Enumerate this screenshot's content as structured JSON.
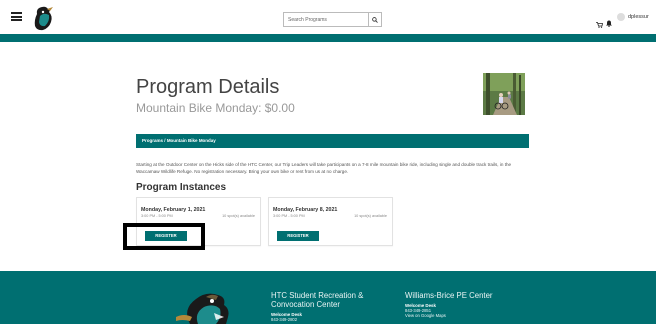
{
  "header": {
    "search_placeholder": "Search Programs",
    "username": "dplessur"
  },
  "program": {
    "title": "Program Details",
    "subtitle": "Mountain Bike Monday: $0.00",
    "breadcrumb": [
      "Programs",
      "Mountain Bike Monday"
    ],
    "breadcrumb_sep": "/",
    "description": "Starting at the Outdoor Center on the Hicks side of the HTC Center, our Trip Leaders will take participants on a 7-8 mile mountain bike ride, including single and double track trails, in the Waccamaw Wildlife Refuge. No registration necessary. Bring your own bike or rent from us at no charge."
  },
  "instances": {
    "heading": "Program Instances",
    "items": [
      {
        "date": "Monday, February 1, 2021",
        "time": "3:00 PM - 5:00 PM",
        "spots": "10 spot(s) available",
        "button": "REGISTER"
      },
      {
        "date": "Monday, February 8, 2021",
        "time": "3:00 PM - 5:00 PM",
        "spots": "10 spot(s) available",
        "button": "REGISTER"
      }
    ]
  },
  "footer": {
    "col1": {
      "title": "HTC Student Recreation & Convocation Center",
      "desk": "Welcome Desk",
      "phone": "843-349-2802"
    },
    "col2": {
      "title": "Williams-Brice PE Center",
      "desk": "Welcome Desk",
      "phone": "843-349-2851",
      "link": "View on Google Maps"
    }
  },
  "colors": {
    "brand": "#006f71",
    "highlight": "#000000"
  }
}
